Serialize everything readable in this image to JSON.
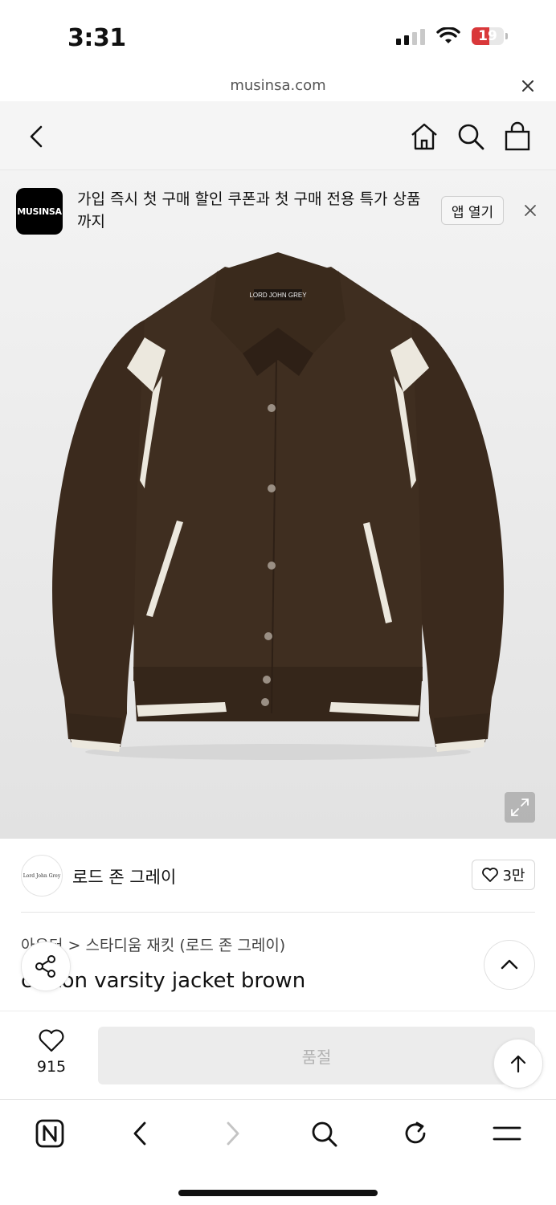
{
  "status_bar": {
    "time": "3:31",
    "battery": "19",
    "colors": {
      "battery_low": "#d9383a"
    }
  },
  "browser": {
    "url": "musinsa.com"
  },
  "banner": {
    "logo_text": "MUSINSA",
    "message": "가입 즉시 첫 구매 할인 쿠폰과 첫 구매 전용 특가 상품까지",
    "open_app_label": "앱 열기"
  },
  "product_image": {
    "label_text": "LORD JOHN GREY",
    "colors": {
      "jacket": "#3b2a1d",
      "trim": "#ece8de"
    }
  },
  "brand": {
    "avatar_text": "Lord John Grey",
    "name": "로드 존 그레이",
    "like_count": "3만"
  },
  "product": {
    "breadcrumb_prefix": "아우터",
    "breadcrumb_separator": ">",
    "breadcrumb_category": "스타디움 재킷 (로드 존 그레이)",
    "title": "cotton varsity jacket brown"
  },
  "purchase": {
    "wish_count": "915",
    "soldout_label": "품절"
  },
  "icons": [
    "back-icon",
    "home-icon",
    "search-icon",
    "bag-icon",
    "close-icon",
    "expand-icon",
    "heart-icon",
    "share-icon",
    "chevron-up-icon",
    "arrow-up-icon",
    "naver-icon",
    "forward-icon",
    "reload-icon",
    "menu-icon"
  ]
}
